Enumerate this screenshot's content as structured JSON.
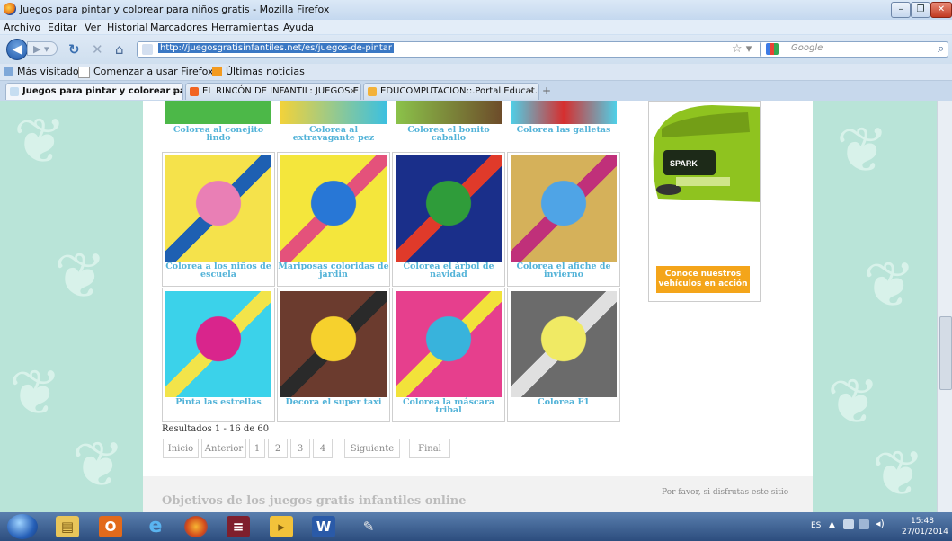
{
  "window": {
    "title": "Juegos para pintar y colorear para niños gratis - Mozilla Firefox"
  },
  "menu": {
    "items": [
      "Archivo",
      "Editar",
      "Ver",
      "Historial",
      "Marcadores",
      "Herramientas",
      "Ayuda"
    ]
  },
  "nav": {
    "url": "http://juegosgratisinfantiles.net/es/juegos-de-pintar",
    "search_placeholder": "Google"
  },
  "bookmarks": {
    "items": [
      "Más visitados",
      "Comenzar a usar Firefox",
      "Últimas noticias"
    ]
  },
  "tabs": [
    {
      "label": "Juegos para pintar y colorear para...",
      "active": true
    },
    {
      "label": "EL RINCÓN DE INFANTIL: JUEGOS E...",
      "active": false
    },
    {
      "label": "EDUCOMPUTACION::.Portal Educat...",
      "active": false
    }
  ],
  "top_row_labels": [
    "Colorea al conejito lindo",
    "Colorea al extravagante pez",
    "Colorea el bonito caballo",
    "Colorea las galletas"
  ],
  "games": [
    {
      "label": "Colorea a los niños de escuela",
      "colors": [
        "#f5e24b",
        "#e97fb5",
        "#1e60b2"
      ]
    },
    {
      "label": "Mariposas coloridas de jardin",
      "colors": [
        "#f4e63c",
        "#2877d6",
        "#e4527b"
      ]
    },
    {
      "label": "Colorea el árbol de navidad",
      "colors": [
        "#1a2f8a",
        "#2f9c3a",
        "#e03a2a"
      ]
    },
    {
      "label": "Colorea el afiche de invierno",
      "colors": [
        "#d5b15a",
        "#4fa4e6",
        "#c0307a"
      ]
    },
    {
      "label": "Pinta las estrellas",
      "colors": [
        "#3bd2ea",
        "#d9258c",
        "#f2e44a"
      ]
    },
    {
      "label": "Decora el super taxi",
      "colors": [
        "#6b3b2e",
        "#f6d12d",
        "#2a2a2a"
      ]
    },
    {
      "label": "Colorea la máscara tribal",
      "colors": [
        "#e63f8d",
        "#38b3dc",
        "#f2e23a"
      ]
    },
    {
      "label": "Colorea F1",
      "colors": [
        "#6b6b6b",
        "#f0ea64",
        "#e0e0e0"
      ]
    }
  ],
  "results_text": "Resultados 1 - 16 de 60",
  "pagination": [
    "Inicio",
    "Anterior",
    "1",
    "2",
    "3",
    "4",
    "Siguiente",
    "Final"
  ],
  "ad": {
    "brand": "SPARK",
    "cta": "Conoce nuestros vehículos en acción"
  },
  "footer": {
    "left_text": "Objetivos de los juegos gratis infantiles online",
    "right_text": "Por favor, si disfrutas este sitio"
  },
  "taskbar": {
    "lang": "ES",
    "time": "15:48",
    "date": "27/01/2014"
  }
}
